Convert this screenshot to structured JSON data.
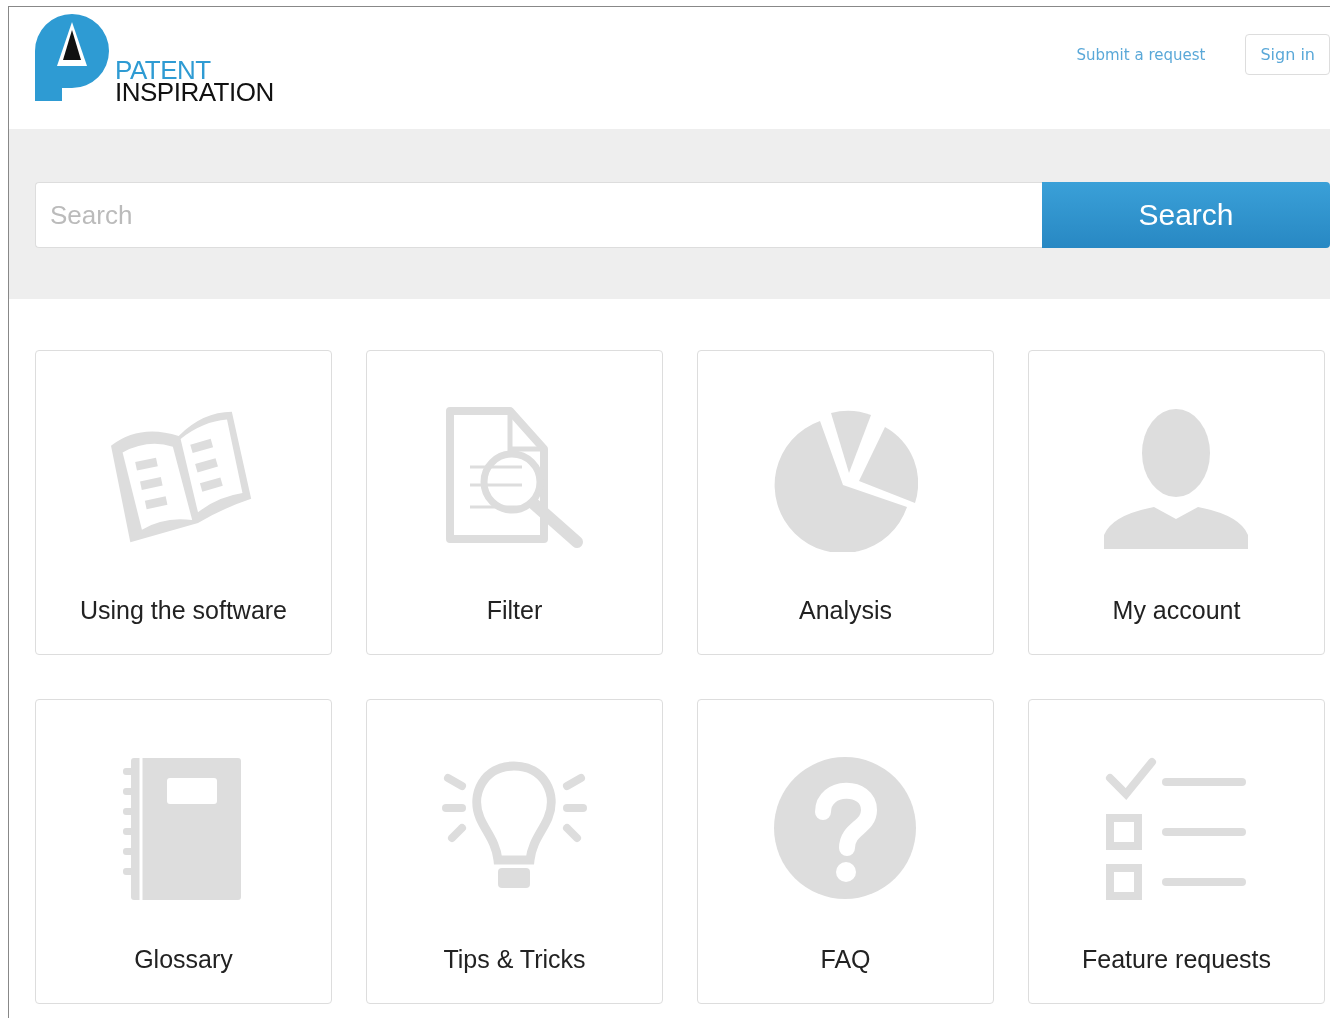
{
  "logo": {
    "line_1": "PATENT",
    "line_2": "INSPIRATION"
  },
  "header_links": {
    "submit": "Submit a request",
    "sign_in": "Sign in"
  },
  "search": {
    "placeholder": "Search",
    "button": "Search"
  },
  "categories": [
    {
      "label": "Using the software"
    },
    {
      "label": "Filter"
    },
    {
      "label": "Analysis"
    },
    {
      "label": "My account"
    },
    {
      "label": "Glossary"
    },
    {
      "label": "Tips & Tricks"
    },
    {
      "label": "FAQ"
    },
    {
      "label": "Feature requests"
    }
  ]
}
